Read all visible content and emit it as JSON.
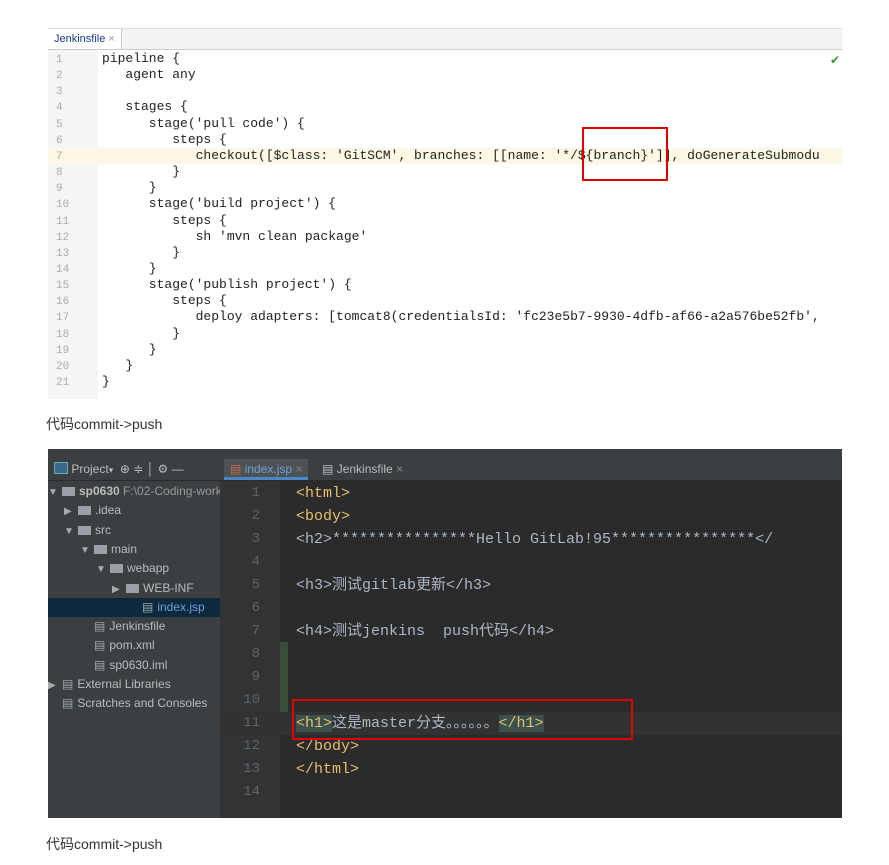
{
  "top_editor": {
    "tab": "Jenkinsfile",
    "lines": [
      "pipeline {",
      "   agent any",
      "",
      "   stages {",
      "      stage('pull code') {",
      "         steps {",
      "            checkout([$class: 'GitSCM', branches: [[name: '*/${branch}']], doGenerateSubmodu",
      "         }",
      "      }",
      "      stage('build project') {",
      "         steps {",
      "            sh 'mvn clean package'",
      "         }",
      "      }",
      "      stage('publish project') {",
      "         steps {",
      "            deploy adapters: [tomcat8(credentialsId: 'fc23e5b7-9930-4dfb-af66-a2a576be52fb',",
      "         }",
      "      }",
      "   }",
      "}"
    ],
    "current_line": 7
  },
  "caption1": "代码commit->push",
  "ide": {
    "project_label": "Project",
    "tabs": [
      "index.jsp",
      "Jenkinsfile"
    ],
    "tree": [
      {
        "label": "sp0630",
        "extra": "F:\\02-Coding-work",
        "depth": 0,
        "arrow": "▼"
      },
      {
        "label": ".idea",
        "depth": 1,
        "arrow": "▶"
      },
      {
        "label": "src",
        "depth": 1,
        "arrow": "▼"
      },
      {
        "label": "main",
        "depth": 2,
        "arrow": "▼"
      },
      {
        "label": "webapp",
        "depth": 3,
        "arrow": "▼"
      },
      {
        "label": "WEB-INF",
        "depth": 4,
        "arrow": "▶"
      },
      {
        "label": "index.jsp",
        "depth": 5,
        "arrow": ""
      },
      {
        "label": "Jenkinsfile",
        "depth": 2,
        "arrow": ""
      },
      {
        "label": "pom.xml",
        "depth": 2,
        "arrow": ""
      },
      {
        "label": "sp0630.iml",
        "depth": 2,
        "arrow": ""
      },
      {
        "label": "External Libraries",
        "depth": 0,
        "arrow": "▶"
      },
      {
        "label": "Scratches and Consoles",
        "depth": 0,
        "arrow": ""
      }
    ],
    "code": [
      "<html>",
      "<body>",
      "<h2>****************Hello GitLab!95****************</",
      "",
      "<h3>测试gitlab更新</h3>",
      "",
      "<h4>测试jenkins  push代码</h4>",
      "",
      "",
      "",
      "<h1>这是master分支。。。。。。</h1>",
      "</body>",
      "</html>",
      ""
    ],
    "h1_open": "<h1>",
    "h1_text": "这是master分支。。。。。。",
    "h1_close": "</h1>",
    "current_line": 11
  },
  "caption2": "代码commit->push"
}
